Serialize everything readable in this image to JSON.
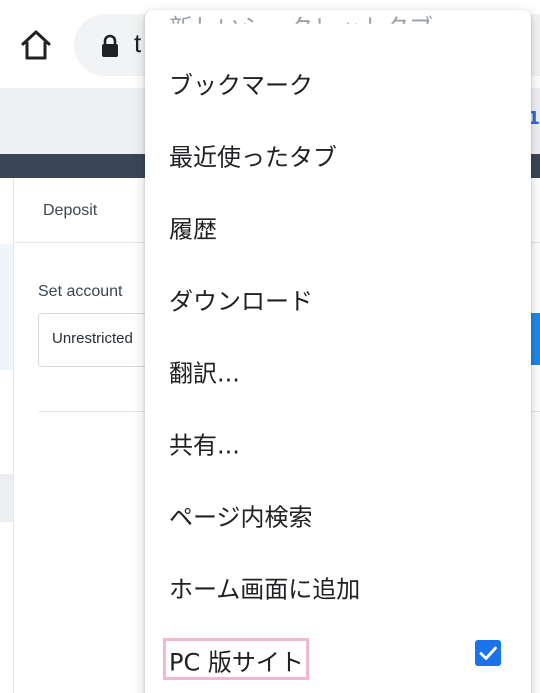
{
  "browser": {
    "url_partial": "t",
    "home_icon": "home-icon",
    "lock_icon": "lock-icon"
  },
  "site": {
    "tab_deposit": "Deposit",
    "field_label": "Set account",
    "field_value": "Unrestricted",
    "nav_edge_text": "1"
  },
  "menu": {
    "items": [
      {
        "label": "新しいシークレットタブ",
        "partially_visible": true
      },
      {
        "label": "ブックマーク"
      },
      {
        "label": "最近使ったタブ"
      },
      {
        "label": "履歴"
      },
      {
        "label": "ダウンロード"
      },
      {
        "label": "翻訳..."
      },
      {
        "label": "共有..."
      },
      {
        "label": "ページ内検索"
      },
      {
        "label": "ホーム画面に追加"
      },
      {
        "label": "PC 版サイト",
        "checked": true,
        "highlighted": true
      }
    ]
  },
  "colors": {
    "accent": "#1a73e8",
    "highlight_border": "#f2b8d2",
    "dark_band": "#3a4556"
  }
}
